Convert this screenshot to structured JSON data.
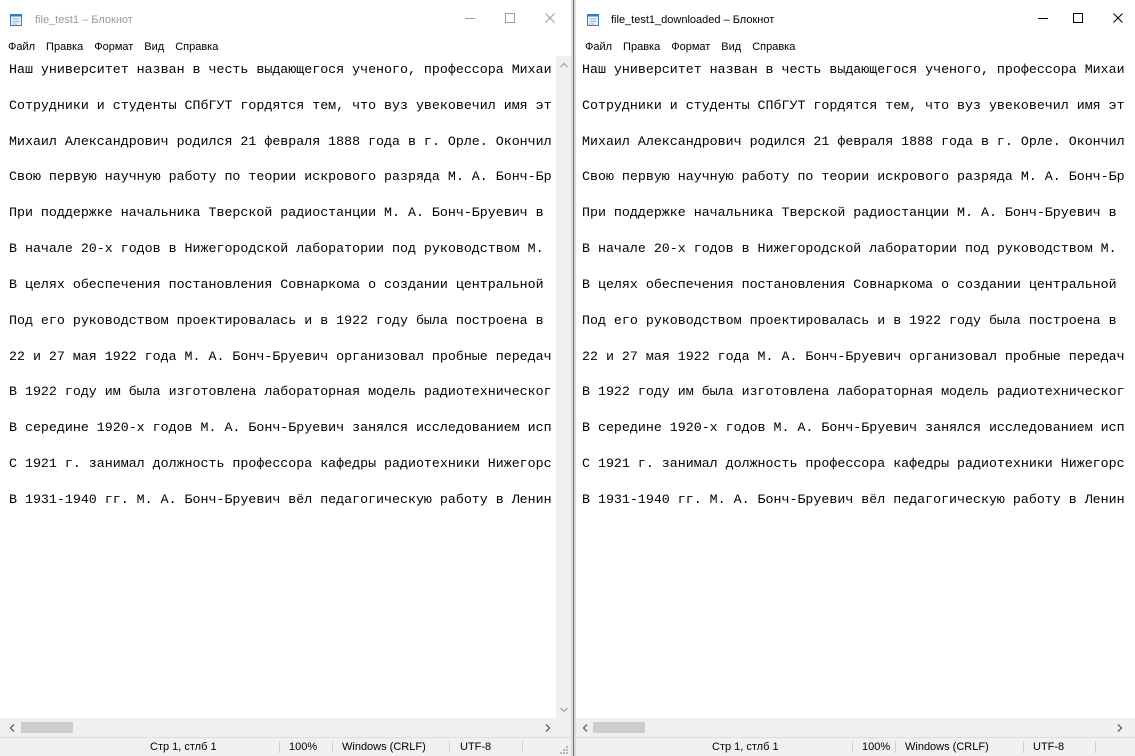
{
  "icons": {
    "app": "notepad-icon",
    "minimize": "minimize-icon",
    "maximize": "maximize-icon",
    "close": "close-icon",
    "scroll_up": "chevron-up-icon",
    "scroll_down": "chevron-down-icon",
    "scroll_left": "chevron-left-icon",
    "scroll_right": "chevron-right-icon",
    "resize_grip": "resize-grip-icon"
  },
  "colors": {
    "inactive_title_text": "#9a9a9a",
    "active_title_text": "#000000",
    "chrome_background": "#f0f0f0",
    "scroll_thumb": "#cdcdcd",
    "app_icon_blue": "#3d7bbd"
  },
  "windows": [
    {
      "title": "file_test1 – Блокнот",
      "menu": [
        "Файл",
        "Правка",
        "Формат",
        "Вид",
        "Справка"
      ],
      "lines": [
        "Наш университет назван в честь выдающегося ученого, профессора Михаи",
        "Сотрудники и студенты СПбГУТ гордятся тем, что вуз увековечил имя эт",
        "Михаил Александрович родился 21 февраля 1888 года в г. Орле. Окончил",
        "Свою первую научную работу по теории искрового разряда М. А. Бонч-Бр",
        "При поддержке начальника Тверской радиостанции М. А. Бонч-Бруевич в",
        "В начале 20-х годов в Нижегородской лаборатории под руководством М.",
        "В целях обеспечения постановления Совнаркома о создании центральной",
        "Под его руководством проектировалась и в 1922 году была построена в",
        "22 и 27 мая 1922 года М. А. Бонч-Бруевич организовал пробные передач",
        "В 1922 году им была изготовлена лабораторная модель радиотехническог",
        "В середине 1920-х годов М. А. Бонч-Бруевич занялся исследованием исп",
        "С 1921 г. занимал должность профессора кафедры радиотехники Нижегорс",
        "В 1931-1940 гг. М. А. Бонч-Бруевич вёл педагогическую работу в Ленин"
      ],
      "hscroll": {
        "position": 0,
        "visible_fraction": 0.1
      },
      "status": {
        "position": "Стр 1, стлб 1",
        "zoom": "100%",
        "line_ending": "Windows (CRLF)",
        "encoding": "UTF-8"
      }
    },
    {
      "title": "file_test1_downloaded – Блокнот",
      "menu": [
        "Файл",
        "Правка",
        "Формат",
        "Вид",
        "Справка"
      ],
      "lines": [
        "Наш университет назван в честь выдающегося ученого, профессора Михаи",
        "Сотрудники и студенты СПбГУТ гордятся тем, что вуз увековечил имя эт",
        "Михаил Александрович родился 21 февраля 1888 года в г. Орле. Окончил",
        "Свою первую научную работу по теории искрового разряда М. А. Бонч-Бр",
        "При поддержке начальника Тверской радиостанции М. А. Бонч-Бруевич в",
        "В начале 20-х годов в Нижегородской лаборатории под руководством М.",
        "В целях обеспечения постановления Совнаркома о создании центральной",
        "Под его руководством проектировалась и в 1922 году была построена в",
        "22 и 27 мая 1922 года М. А. Бонч-Бруевич организовал пробные передач",
        "В 1922 году им была изготовлена лабораторная модель радиотехническог",
        "В середине 1920-х годов М. А. Бонч-Бруевич занялся исследованием исп",
        "С 1921 г. занимал должность профессора кафедры радиотехники Нижегорс",
        "В 1931-1940 гг. М. А. Бонч-Бруевич вёл педагогическую работу в Ленин"
      ],
      "hscroll": {
        "position": 0,
        "visible_fraction": 0.1
      },
      "status": {
        "position": "Стр 1, стлб 1",
        "zoom": "100%",
        "line_ending": "Windows (CRLF)",
        "encoding": "UTF-8"
      }
    }
  ]
}
